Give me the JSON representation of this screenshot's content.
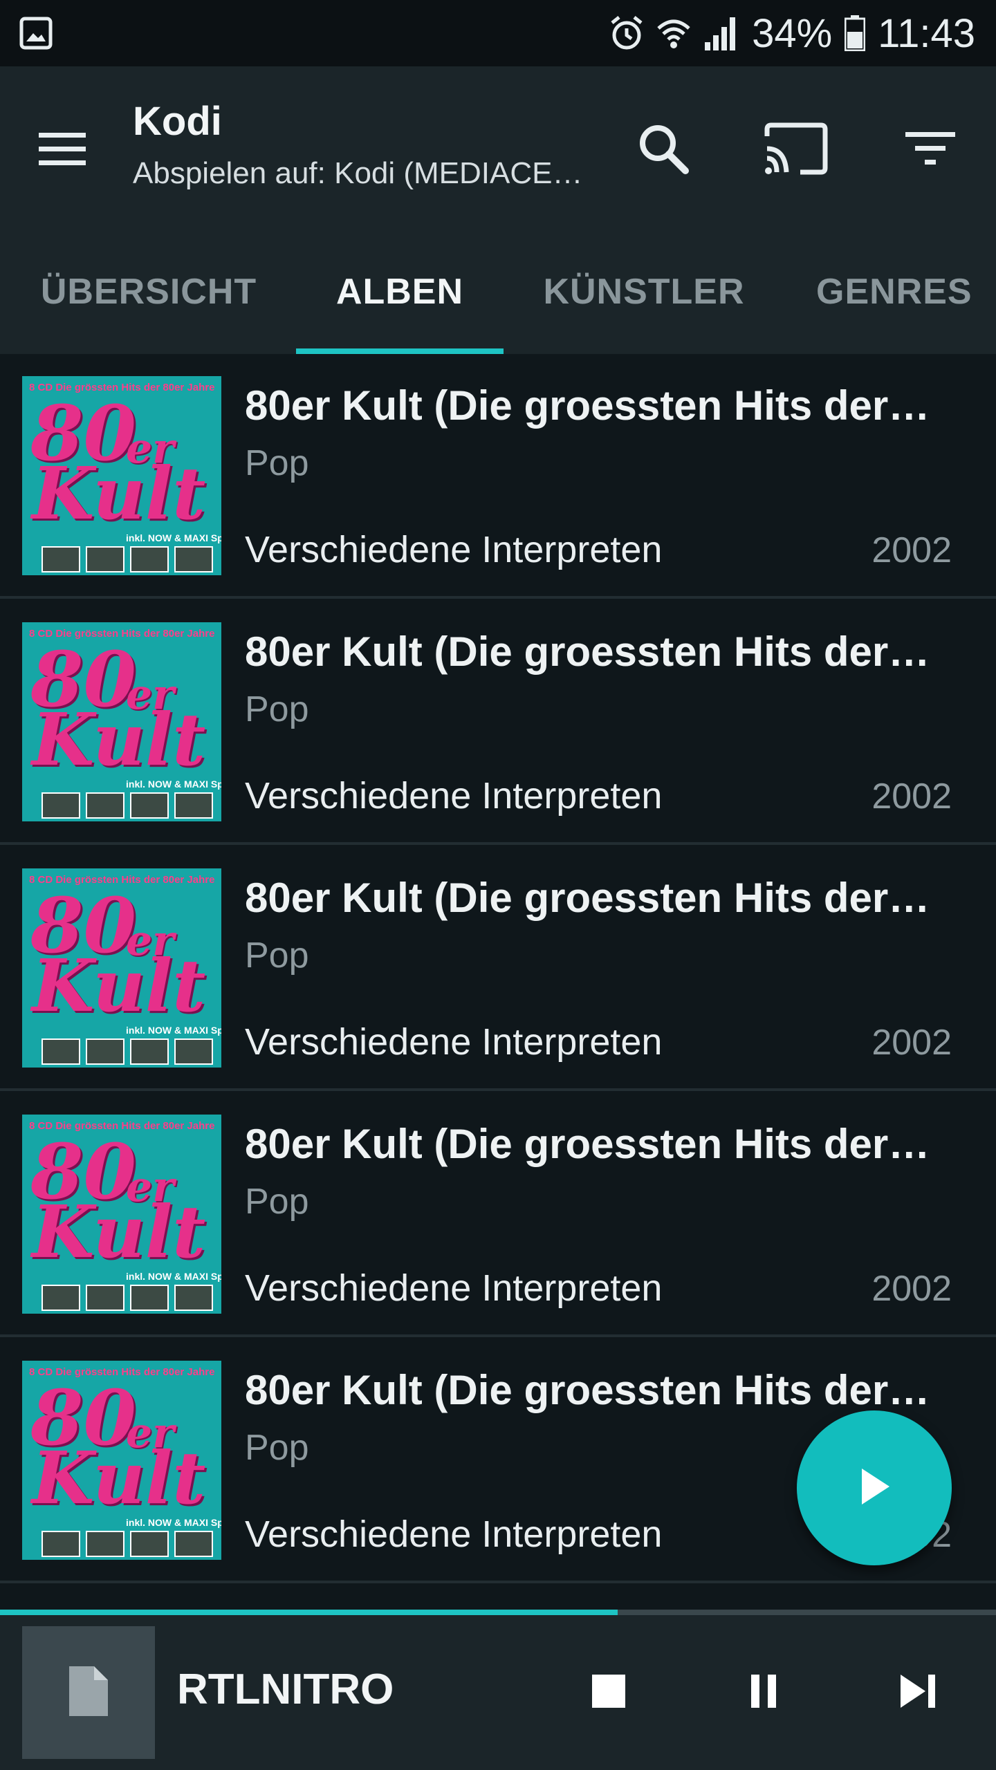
{
  "status_bar": {
    "battery": "34%",
    "time": "11:43",
    "left_icon": "gallery-icon",
    "icons": [
      "alarm-icon",
      "wifi-icon",
      "signal-icon",
      "battery-icon"
    ]
  },
  "app_bar": {
    "title": "Kodi",
    "subtitle": "Abspielen auf: Kodi (MEDIACE…",
    "icons": [
      "menu-icon",
      "search-icon",
      "cast-icon",
      "filter-icon"
    ]
  },
  "tabs": [
    {
      "label": "ÜBERSICHT",
      "active": false
    },
    {
      "label": "ALBEN",
      "active": true
    },
    {
      "label": "KÜNSTLER",
      "active": false
    },
    {
      "label": "GENRES",
      "active": false
    }
  ],
  "albums": [
    {
      "title": "80er Kult (Die groessten Hits der …",
      "genre": "Pop",
      "artist": "Verschiedene Interpreten",
      "year": "2002"
    },
    {
      "title": "80er Kult (Die groessten Hits der …",
      "genre": "Pop",
      "artist": "Verschiedene Interpreten",
      "year": "2002"
    },
    {
      "title": "80er Kult (Die groessten Hits der …",
      "genre": "Pop",
      "artist": "Verschiedene Interpreten",
      "year": "2002"
    },
    {
      "title": "80er Kult (Die groessten Hits der …",
      "genre": "Pop",
      "artist": "Verschiedene Interpreten",
      "year": "2002"
    },
    {
      "title": "80er Kult (Die groessten Hits der …",
      "genre": "Pop",
      "artist": "Verschiedene Interpreten",
      "year": "2002"
    }
  ],
  "cover_art": {
    "top": "8 CD  Die grössten Hits der 80er Jahre",
    "big": "80",
    "er": "er",
    "kult": "Kult",
    "sub": "inkl. NOW & MAXI Special!"
  },
  "progress": 0.62,
  "now_playing": {
    "title": "RTLNITRO",
    "icons": [
      "file-icon",
      "stop-icon",
      "pause-icon",
      "skip-next-icon"
    ]
  },
  "colors": {
    "accent": "#1ec4c4",
    "app_bar": "#1b2529",
    "background": "#0f171b"
  }
}
